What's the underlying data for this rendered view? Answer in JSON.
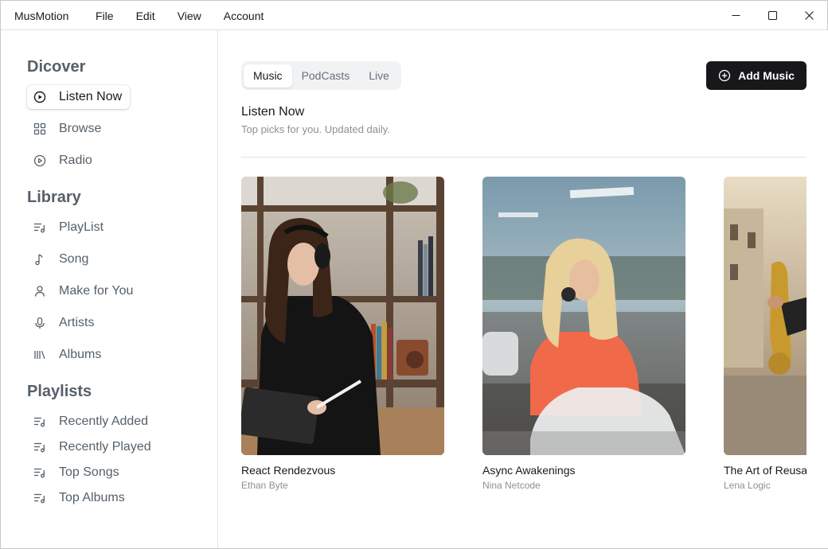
{
  "app": {
    "name": "MusMotion",
    "menu": [
      "File",
      "Edit",
      "View",
      "Account"
    ]
  },
  "sidebar": {
    "sections": [
      {
        "title": "Dicover",
        "items": [
          {
            "label": "Listen Now",
            "icon": "play-circle-icon",
            "active": true
          },
          {
            "label": "Browse",
            "icon": "grid-icon",
            "active": false
          },
          {
            "label": "Radio",
            "icon": "radio-icon",
            "active": false
          }
        ]
      },
      {
        "title": "Library",
        "items": [
          {
            "label": "PlayList",
            "icon": "playlist-icon",
            "active": false
          },
          {
            "label": "Song",
            "icon": "music-note-icon",
            "active": false
          },
          {
            "label": "Make for You",
            "icon": "user-icon",
            "active": false
          },
          {
            "label": "Artists",
            "icon": "microphone-icon",
            "active": false
          },
          {
            "label": "Albums",
            "icon": "library-icon",
            "active": false
          }
        ]
      },
      {
        "title": "Playlists",
        "items": [
          {
            "label": "Recently Added",
            "icon": "playlist-icon",
            "active": false
          },
          {
            "label": "Recently Played",
            "icon": "playlist-icon",
            "active": false
          },
          {
            "label": "Top Songs",
            "icon": "playlist-icon",
            "active": false
          },
          {
            "label": "Top Albums",
            "icon": "playlist-icon",
            "active": false
          }
        ]
      }
    ]
  },
  "main": {
    "tabs": [
      {
        "label": "Music",
        "active": true
      },
      {
        "label": "PodCasts",
        "active": false
      },
      {
        "label": "Live",
        "active": false
      }
    ],
    "add_button": "Add Music",
    "heading": "Listen Now",
    "subheading": "Top picks for you. Updated daily.",
    "cards": [
      {
        "title": "React Rendezvous",
        "artist": "Ethan Byte"
      },
      {
        "title": "Async Awakenings",
        "artist": "Nina Netcode"
      },
      {
        "title": "The Art of Reusability",
        "artist": "Lena Logic"
      }
    ]
  },
  "colors": {
    "accent": "#18181b",
    "muted_text": "#55606a",
    "subtle_text": "#8a9096"
  }
}
